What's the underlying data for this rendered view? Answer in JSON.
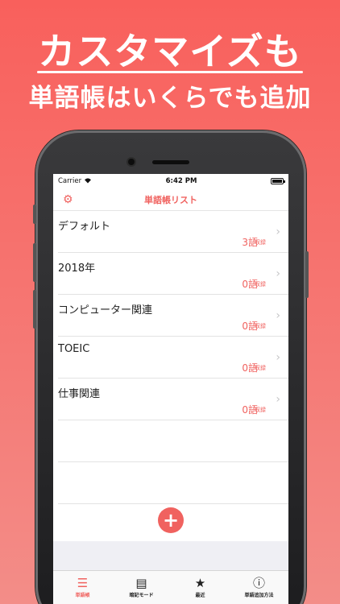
{
  "headline": {
    "line1": "カスタマイズも",
    "line2": "単語帳はいくらでも追加"
  },
  "status_bar": {
    "carrier": "Carrier",
    "time": "6:42 PM"
  },
  "navbar": {
    "title": "単語帳リスト"
  },
  "word_lists": [
    {
      "name": "デフォルト",
      "count": "3語",
      "unit": "収録"
    },
    {
      "name": "2018年",
      "count": "0語",
      "unit": "収録"
    },
    {
      "name": "コンピューター関連",
      "count": "0語",
      "unit": "収録"
    },
    {
      "name": "TOEIC",
      "count": "0語",
      "unit": "収録"
    },
    {
      "name": "仕事関連",
      "count": "0語",
      "unit": "収録"
    }
  ],
  "tabbar": {
    "tabs": [
      {
        "label": "単語帳",
        "icon": "list-icon",
        "active": true
      },
      {
        "label": "暗記モード",
        "icon": "document-icon",
        "active": false
      },
      {
        "label": "最近",
        "icon": "star-icon",
        "active": false
      },
      {
        "label": "単語追加方法",
        "icon": "info-icon",
        "active": false
      }
    ]
  },
  "colors": {
    "accent": "#f0625f",
    "background": "#f9605c"
  }
}
